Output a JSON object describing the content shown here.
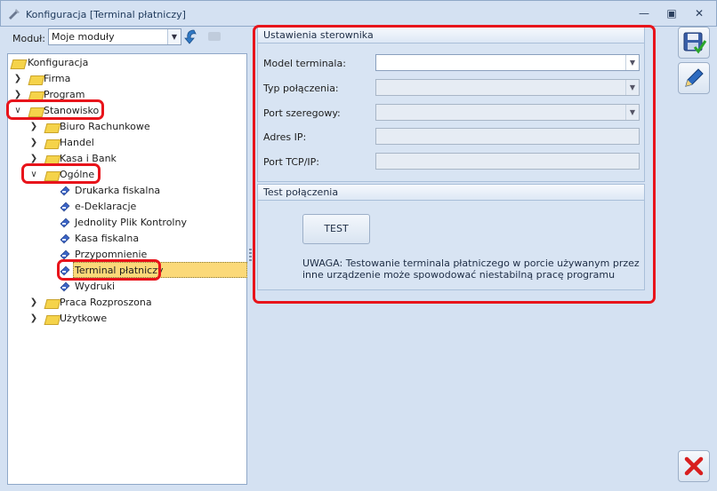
{
  "window": {
    "title": "Konfiguracja [Terminal płatniczy]",
    "controls": [
      "minimize-icon",
      "restore-icon",
      "close-icon"
    ]
  },
  "toolbar": {
    "module_label": "Moduł:",
    "module_value": "Moje moduły"
  },
  "tree": {
    "root": "Konfiguracja",
    "items": [
      {
        "label": "Firma"
      },
      {
        "label": "Program"
      },
      {
        "label": "Stanowisko"
      },
      {
        "label": "Biuro Rachunkowe"
      },
      {
        "label": "Handel"
      },
      {
        "label": "Kasa i Bank"
      },
      {
        "label": "Ogólne"
      },
      {
        "label": "Drukarka fiskalna"
      },
      {
        "label": "e-Deklaracje"
      },
      {
        "label": "Jednolity Plik Kontrolny"
      },
      {
        "label": "Kasa fiskalna"
      },
      {
        "label": "Przypomnienie"
      },
      {
        "label": "Terminal płatniczy"
      },
      {
        "label": "Wydruki"
      },
      {
        "label": "Praca Rozproszona"
      },
      {
        "label": "Użytkowe"
      }
    ],
    "selected": "Terminal płatniczy"
  },
  "settings": {
    "group_title": "Ustawienia sterownika",
    "fields": [
      {
        "label": "Model terminala:",
        "value": ""
      },
      {
        "label": "Typ połączenia:",
        "value": ""
      },
      {
        "label": "Port szeregowy:",
        "value": ""
      },
      {
        "label": "Adres IP:",
        "value": ""
      },
      {
        "label": "Port TCP/IP:",
        "value": ""
      }
    ]
  },
  "test": {
    "group_title": "Test połączenia",
    "button_label": "TEST",
    "warning": "UWAGA: Testowanie terminala płatniczego w porcie używanym przez inne urządzenie może spowodować niestabilną pracę programu"
  },
  "colors": {
    "highlight_red": "#e8141b",
    "selection": "#fbd979",
    "background": "#d4e1f2"
  }
}
